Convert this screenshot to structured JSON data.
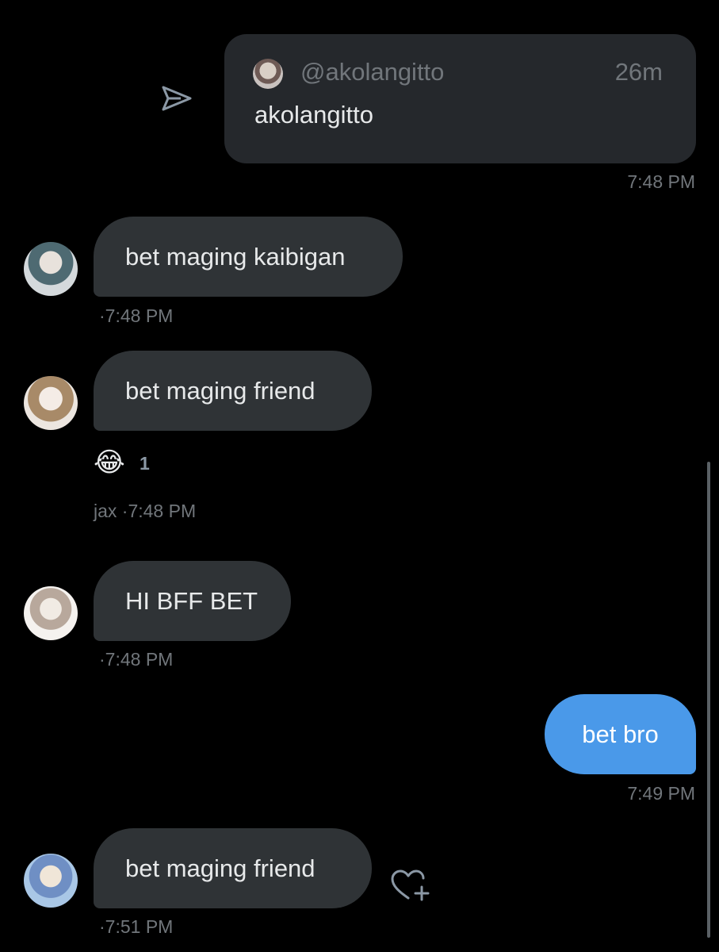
{
  "shared_post": {
    "handle": "@akolangitto",
    "age": "26m",
    "name": "akolangitto",
    "sent_time": "7:48 PM"
  },
  "messages": [
    {
      "text": "bet maging kaibigan",
      "meta": "·7:48 PM"
    },
    {
      "text": "bet maging friend",
      "reaction": "😂",
      "reaction_count": "1",
      "meta": "jax ·7:48 PM"
    },
    {
      "text": "HI BFF BET",
      "meta": "·7:48 PM"
    },
    {
      "text": "bet bro",
      "meta": "7:49 PM"
    },
    {
      "text": "bet maging friend",
      "meta": "·7:51 PM"
    }
  ],
  "icons": {
    "send": "send-icon",
    "react": "heart-plus-icon"
  },
  "colors": {
    "background": "#000000",
    "incoming_bubble": "#2f3336",
    "outgoing_bubble": "#4a99e9",
    "muted_text": "#71767b"
  }
}
